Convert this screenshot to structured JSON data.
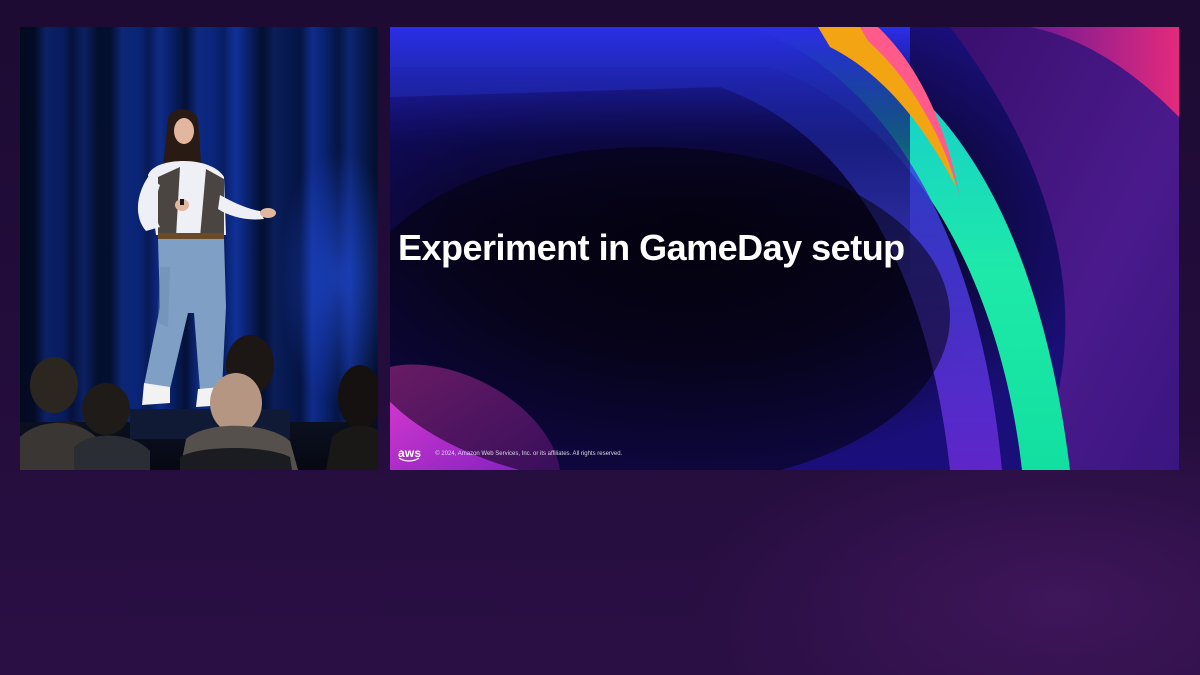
{
  "slide": {
    "title": "Experiment in GameDay setup",
    "logo_text": "aws",
    "copyright": "© 2024, Amazon Web Services, Inc. or its affiliates. All rights reserved."
  },
  "colors": {
    "background": "#230d3c",
    "slide_background": "#07031a",
    "accent_green": "#19e6b0",
    "accent_blue": "#2a2cf0",
    "accent_magenta": "#c01cc8",
    "accent_orange": "#f2a413",
    "accent_pink": "#ff2d7a",
    "curtain_blue": "#0b2a8a"
  },
  "icons": [
    "aws-logo-icon"
  ]
}
